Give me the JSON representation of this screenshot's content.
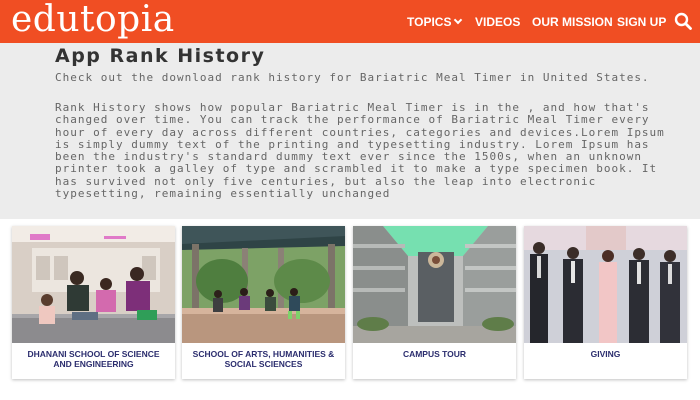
{
  "header": {
    "logo": "edutopia",
    "nav": [
      {
        "label": "TOPICS"
      },
      {
        "label": "VIDEOS"
      },
      {
        "label": "OUR MISSION"
      },
      {
        "label": "SIGN UP"
      }
    ]
  },
  "main": {
    "title": "App Rank History",
    "intro": "Check out the download rank history for Bariatric Meal Timer in United States.",
    "body": "Rank History shows how popular Bariatric Meal Timer is in the , and how that's changed over time. You can track the performance of Bariatric Meal Timer every hour of every day across different countries, categories and devices.Lorem Ipsum is simply dummy text of the printing and typesetting industry. Lorem Ipsum has been the industry's standard dummy text ever since the 1500s, when an unknown printer took a galley of type and scrambled it to make a type specimen book. It has survived not only five centuries, but also the leap into electronic typesetting, remaining essentially unchanged"
  },
  "cards": [
    {
      "label": "DHANANI SCHOOL OF SCIENCE AND ENGINEERING"
    },
    {
      "label": "SCHOOL OF ARTS, HUMANITIES & SOCIAL SCIENCES"
    },
    {
      "label": "CAMPUS TOUR"
    },
    {
      "label": "GIVING"
    }
  ],
  "colors": {
    "brand": "#f04e23",
    "card_text": "#2b2d6e"
  }
}
